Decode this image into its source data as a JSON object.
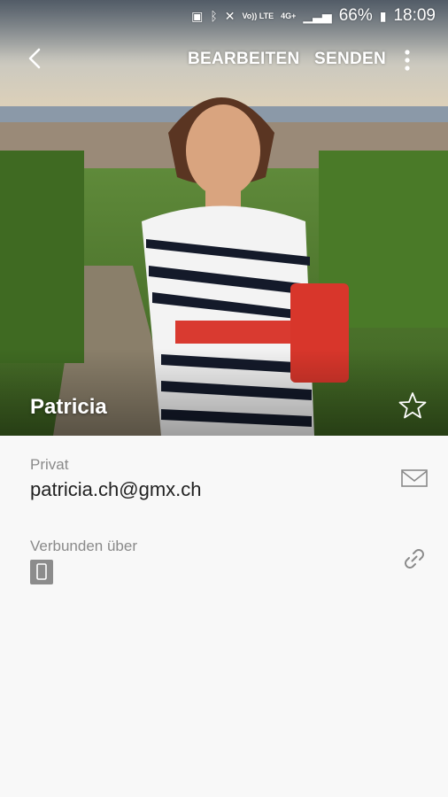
{
  "status_bar": {
    "battery_percent": "66%",
    "time": "18:09",
    "volte_label": "Vo)) LTE",
    "network_label": "4G+"
  },
  "header": {
    "edit_label": "BEARBEITEN",
    "send_label": "SENDEN"
  },
  "contact": {
    "name": "Patricia",
    "favorite": false
  },
  "fields": [
    {
      "label": "Privat",
      "value": "patricia.ch@gmx.ch",
      "icon": "mail-icon"
    },
    {
      "label": "Verbunden über",
      "icon": "link-icon",
      "linked_account_icon": "phone-device-icon"
    }
  ]
}
